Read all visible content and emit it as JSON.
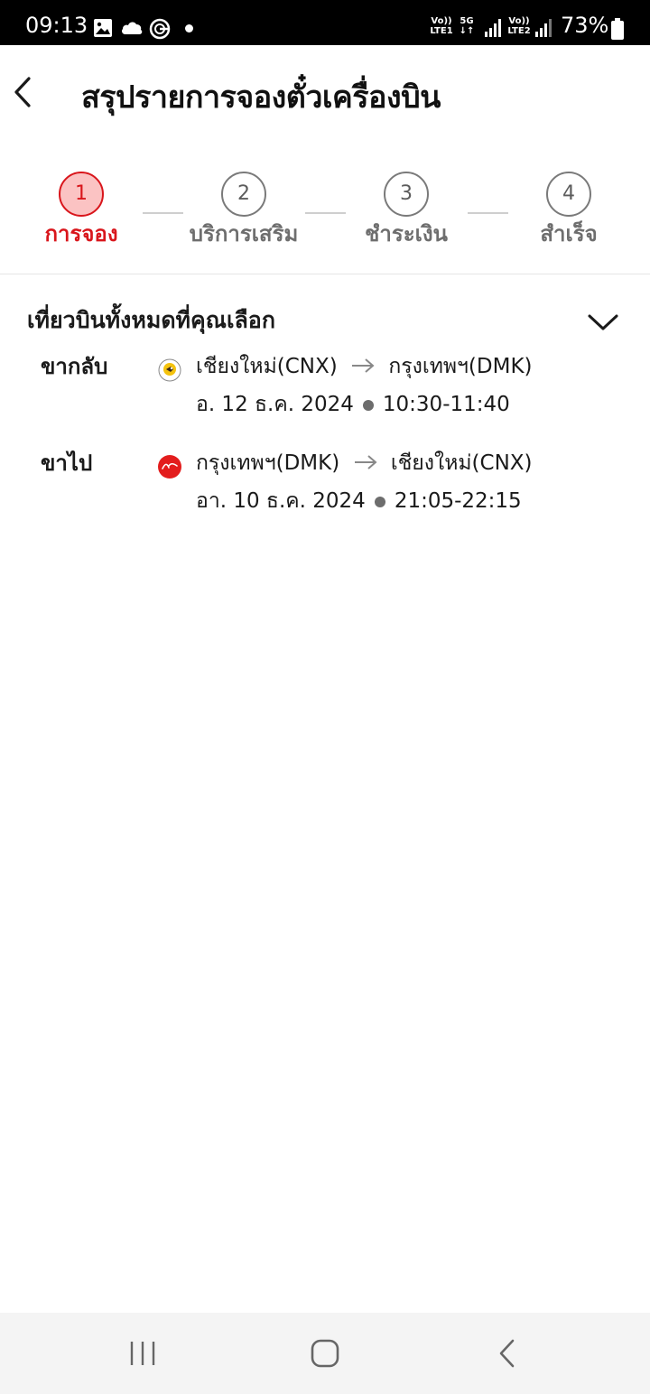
{
  "status_bar": {
    "time": "09:13",
    "icons": [
      "gallery-icon",
      "cloud-icon",
      "g-app-icon",
      "notification-dot"
    ],
    "net1_top": "Vo))",
    "net1_bottom": "LTE1",
    "net_5g": "5G",
    "net2_top": "Vo))",
    "net2_bottom": "LTE2",
    "battery": "73%"
  },
  "header": {
    "back_icon": "chevron-left-icon",
    "title": "สรุปรายการจองตั๋วเครื่องบิน"
  },
  "stepper": {
    "active_step": 1,
    "accent_color": "#d9161c",
    "steps": [
      {
        "number": "1",
        "label": "การจอง"
      },
      {
        "number": "2",
        "label": "บริการเสริม"
      },
      {
        "number": "3",
        "label": "ชำระเงิน"
      },
      {
        "number": "4",
        "label": "สำเร็จ"
      }
    ]
  },
  "flights": {
    "section_title": "เที่ยวบินทั้งหมดที่คุณเลือก",
    "toggle_icon": "chevron-down-icon",
    "legs": [
      {
        "label": "ขากลับ",
        "airline_icon": "nok-air-logo-icon",
        "origin": "เชียงใหม่(CNX)",
        "destination": "กรุงเทพฯ(DMK)",
        "date": "อ. 12 ธ.ค. 2024",
        "time": "10:30-11:40"
      },
      {
        "label": "ขาไป",
        "airline_icon": "airasia-logo-icon",
        "origin": "กรุงเทพฯ(DMK)",
        "destination": "เชียงใหม่(CNX)",
        "date": "อา. 10 ธ.ค. 2024",
        "time": "21:05-22:15"
      }
    ]
  },
  "nav_bar": {
    "buttons": [
      "recent-apps-icon",
      "home-icon",
      "back-icon"
    ]
  }
}
